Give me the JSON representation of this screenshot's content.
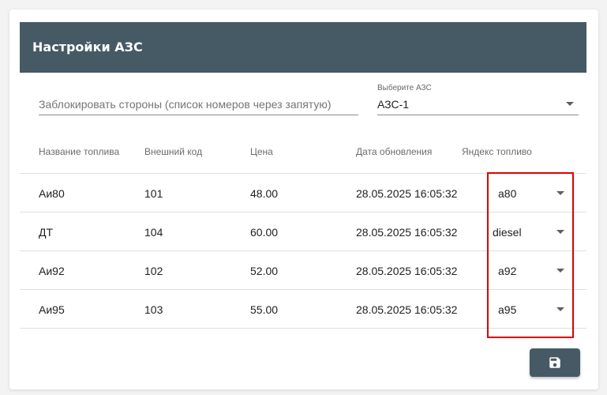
{
  "header": {
    "title": "Настройки АЗС"
  },
  "block_sides": {
    "placeholder": "Заблокировать стороны (список номеров через запятую)",
    "value": ""
  },
  "station_select": {
    "label": "Выберите АЗС",
    "value": "АЗС-1"
  },
  "table": {
    "columns": [
      "Название топлива",
      "Внешний код",
      "Цена",
      "Дата обновления",
      "Яндекс топливо"
    ],
    "rows": [
      {
        "name": "Аи80",
        "code": "101",
        "price": "48.00",
        "updated": "28.05.2025 16:05:32",
        "yandex_fuel": "a80"
      },
      {
        "name": "ДТ",
        "code": "104",
        "price": "60.00",
        "updated": "28.05.2025 16:05:32",
        "yandex_fuel": "diesel"
      },
      {
        "name": "Аи92",
        "code": "102",
        "price": "52.00",
        "updated": "28.05.2025 16:05:32",
        "yandex_fuel": "a92"
      },
      {
        "name": "Аи95",
        "code": "103",
        "price": "55.00",
        "updated": "28.05.2025 16:05:32",
        "yandex_fuel": "a95"
      }
    ]
  },
  "save_button": {
    "icon": "floppy-disk-icon"
  },
  "colors": {
    "header_bg": "#455a64",
    "highlight": "#e10000",
    "button_bg": "#455a64"
  }
}
